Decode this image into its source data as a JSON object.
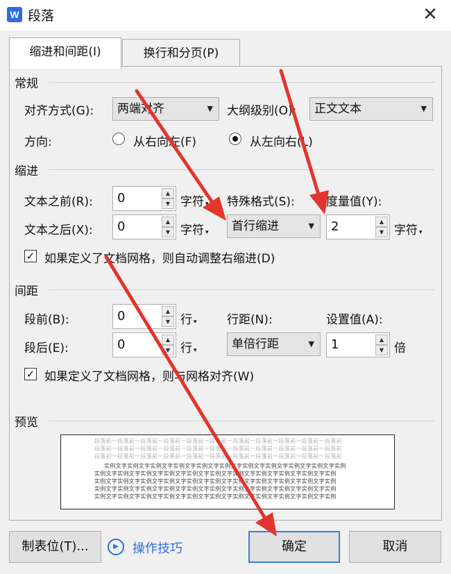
{
  "window": {
    "title": "段落",
    "app_icon": "W",
    "close_symbol": "✕"
  },
  "tabs": [
    {
      "label": "缩进和间距(I)",
      "active": true
    },
    {
      "label": "换行和分页(P)",
      "active": false
    }
  ],
  "general": {
    "title": "常规",
    "alignment_label": "对齐方式(G):",
    "alignment_value": "两端对齐",
    "outline_label": "大纲级别(O):",
    "outline_value": "正文文本",
    "direction_label": "方向:",
    "rtl_label": "从右向左(F)",
    "ltr_label": "从左向右(L)",
    "direction_selected": "ltr"
  },
  "indent": {
    "title": "缩进",
    "before_label": "文本之前(R):",
    "before_value": "0",
    "before_unit": "字符",
    "after_label": "文本之后(X):",
    "after_value": "0",
    "after_unit": "字符",
    "special_label": "特殊格式(S):",
    "special_value": "首行缩进",
    "measure_label": "度量值(Y):",
    "measure_value": "2",
    "measure_unit": "字符",
    "auto_adjust_label": "如果定义了文档网格，则自动调整右缩进(D)",
    "auto_adjust_checked": true
  },
  "spacing": {
    "title": "间距",
    "before_label": "段前(B):",
    "before_value": "0",
    "before_unit": "行",
    "after_label": "段后(E):",
    "after_value": "0",
    "after_unit": "行",
    "line_label": "行距(N):",
    "line_value": "单倍行距",
    "setting_label": "设置值(A):",
    "setting_value": "1",
    "setting_unit": "倍",
    "snap_label": "如果定义了文档网格，则与网格对齐(W)",
    "snap_checked": true
  },
  "preview": {
    "title": "预览",
    "gray_line": "段落前一段落前一段落前一段落前一段落前一段落前一段落前一段落前一段落前一段落前一段落前",
    "dark_line": "实例文字实例文字实例文字实例文字实例文字实例文字实例文字实例文字实例文字实例文字实例"
  },
  "footer": {
    "tabs_button": "制表位(T)...",
    "tips_label": "操作技巧",
    "ok_button": "确定",
    "cancel_button": "取消"
  },
  "colors": {
    "accent": "#2f6fd6",
    "annotation_arrow": "#e2352b"
  }
}
